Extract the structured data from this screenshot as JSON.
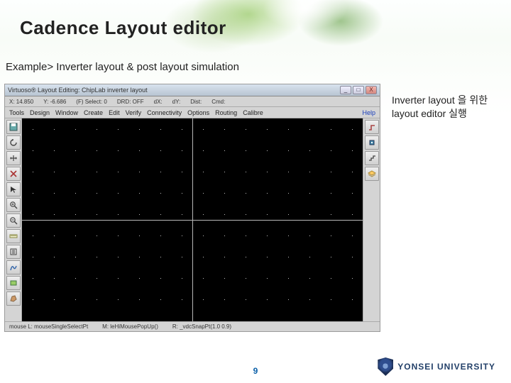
{
  "slide": {
    "title": "Cadence Layout editor",
    "example_line": "Example>  Inverter layout & post layout simulation",
    "annotation_l1": "Inverter layout 을 위한",
    "annotation_l2": "layout editor 실행",
    "page_number": "9"
  },
  "university": {
    "name": "YONSEI UNIVERSITY"
  },
  "editor": {
    "window_title": "Virtuoso® Layout Editing: ChipLab inverter layout",
    "status": {
      "x": "X: 14.850",
      "y": "Y: -6.686",
      "f": "(F) Select: 0",
      "drd": "DRD: OFF",
      "dx": "dX:",
      "dy": "dY:",
      "dist": "Dist:",
      "cmd": "Cmd:"
    },
    "menu": {
      "tools": "Tools",
      "design": "Design",
      "window": "Window",
      "create": "Create",
      "edit": "Edit",
      "verify": "Verify",
      "connectivity": "Connectivity",
      "options": "Options",
      "routing": "Routing",
      "calibre": "Calibre",
      "help": "Help"
    },
    "footer": {
      "mouse": "mouse L: mouseSingleSelectPt",
      "mid": "M: leHiMousePopUp()",
      "right": "R: _vdcSnapPt(1.0 0.9)"
    },
    "winbtn": {
      "min": "_",
      "max": "□",
      "close": "X"
    },
    "icons": {
      "save": "save-icon",
      "undo": "undo-icon",
      "stretch": "stretch-icon",
      "delete": "delete-icon",
      "select": "select-icon",
      "zoomin": "zoom-in-icon",
      "zoomout": "zoom-out-icon",
      "ruler": "ruler-icon",
      "props": "props-icon",
      "path": "path-icon",
      "rect": "rect-icon",
      "poly": "poly-icon",
      "wire": "wire-icon",
      "via": "via-icon",
      "step": "step-icon",
      "layer": "layer-icon"
    }
  }
}
